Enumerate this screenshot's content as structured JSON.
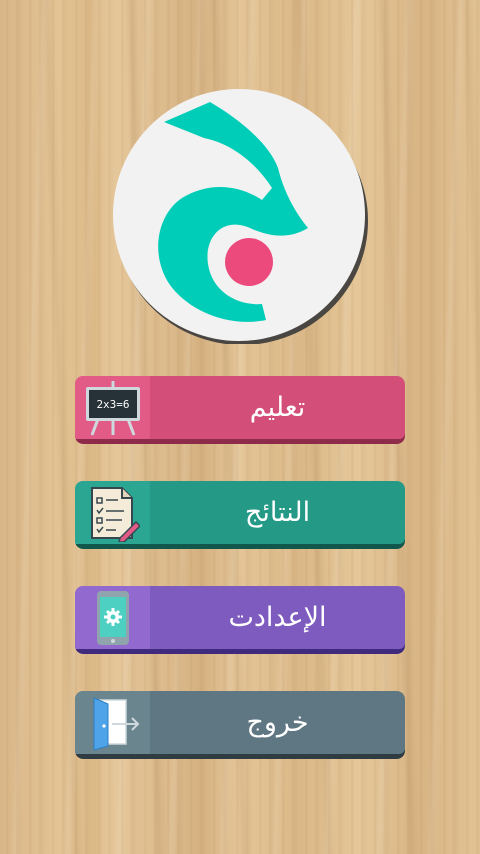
{
  "app": {
    "logo_icon": "arabic-letter-jeem-logo-icon",
    "colors": {
      "teal": "#00cdb7",
      "pink": "#ec4a7d",
      "logo_bg": "#f2f2f2"
    }
  },
  "menu": {
    "items": [
      {
        "label": "تعليم",
        "icon": "chalkboard-icon",
        "board_text": "2x3=6",
        "color": "#d34f79"
      },
      {
        "label": "النتائج",
        "icon": "results-sheet-icon",
        "color": "#239986"
      },
      {
        "label": "الإعدادت",
        "icon": "phone-settings-icon",
        "color": "#7e5bbf"
      },
      {
        "label": "خروج",
        "icon": "exit-door-icon",
        "color": "#5f7782"
      }
    ]
  }
}
